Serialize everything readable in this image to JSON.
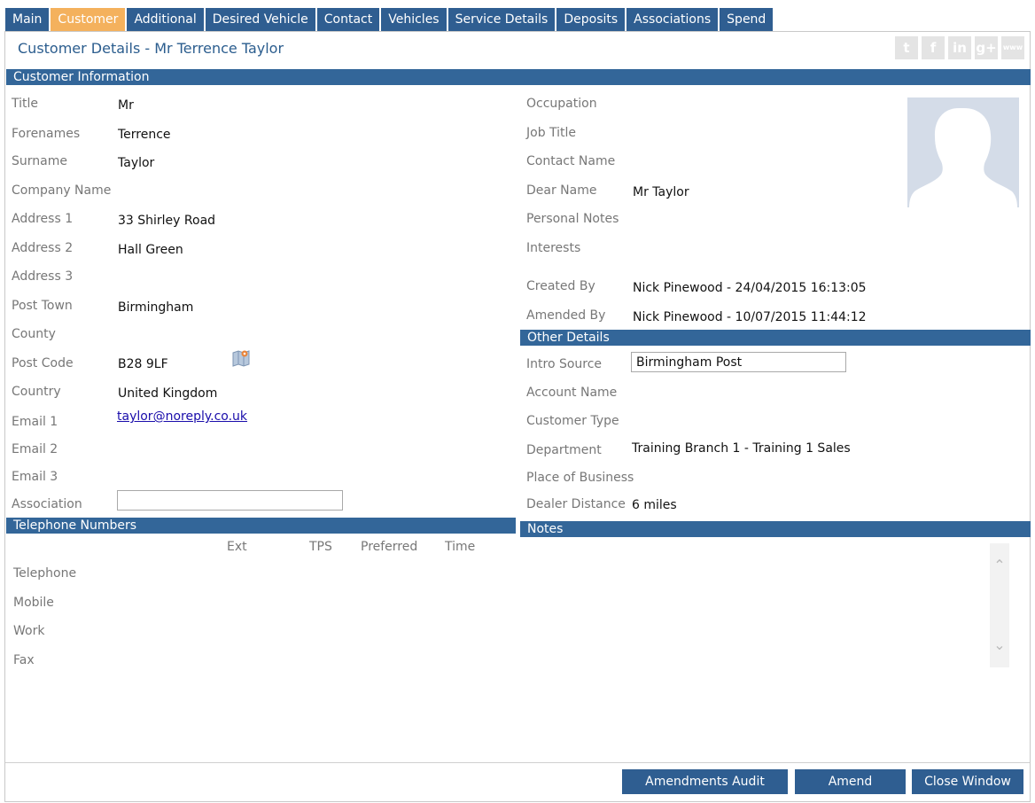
{
  "tabs": [
    "Main",
    "Customer",
    "Additional",
    "Desired Vehicle",
    "Contact",
    "Vehicles",
    "Service Details",
    "Deposits",
    "Associations",
    "Spend"
  ],
  "page_title": "Customer Details - Mr Terrence Taylor",
  "social": [
    "t",
    "f",
    "in",
    "g+",
    "www"
  ],
  "sections": {
    "customer_info": "Customer Information",
    "telephone": "Telephone Numbers",
    "other": "Other Details",
    "notes": "Notes"
  },
  "customer": {
    "title": {
      "label": "Title",
      "value": "Mr"
    },
    "forenames": {
      "label": "Forenames",
      "value": "Terrence"
    },
    "surname": {
      "label": "Surname",
      "value": "Taylor"
    },
    "company": {
      "label": "Company Name",
      "value": ""
    },
    "address1": {
      "label": "Address 1",
      "value": "33 Shirley Road"
    },
    "address2": {
      "label": "Address 2",
      "value": "Hall Green"
    },
    "address3": {
      "label": "Address 3",
      "value": ""
    },
    "post_town": {
      "label": "Post Town",
      "value": "Birmingham"
    },
    "county": {
      "label": "County",
      "value": ""
    },
    "post_code": {
      "label": "Post Code",
      "value": "B28 9LF"
    },
    "country": {
      "label": "Country",
      "value": "United Kingdom"
    },
    "email1": {
      "label": "Email 1",
      "value": "taylor@noreply.co.uk"
    },
    "email2": {
      "label": "Email 2",
      "value": ""
    },
    "email3": {
      "label": "Email 3",
      "value": ""
    },
    "association": {
      "label": "Association",
      "value": ""
    }
  },
  "right": {
    "occupation": {
      "label": "Occupation",
      "value": ""
    },
    "job_title": {
      "label": "Job Title",
      "value": ""
    },
    "contact_name": {
      "label": "Contact Name",
      "value": ""
    },
    "dear_name": {
      "label": "Dear Name",
      "value": "Mr Taylor"
    },
    "personal_notes": {
      "label": "Personal Notes",
      "value": ""
    },
    "interests": {
      "label": "Interests",
      "value": ""
    },
    "created_by": {
      "label": "Created By",
      "value": "Nick Pinewood - 24/04/2015 16:13:05"
    },
    "amended_by": {
      "label": "Amended By",
      "value": "Nick Pinewood - 10/07/2015 11:44:12"
    }
  },
  "other": {
    "intro_source": {
      "label": "Intro Source",
      "value": "Birmingham Post"
    },
    "account_name": {
      "label": "Account Name",
      "value": ""
    },
    "customer_type": {
      "label": "Customer Type",
      "value": ""
    },
    "department": {
      "label": "Department",
      "value": "Training Branch 1 - Training 1 Sales"
    },
    "place_of_business": {
      "label": "Place of Business",
      "value": ""
    },
    "dealer_distance": {
      "label": "Dealer Distance",
      "value": "6 miles"
    }
  },
  "telephone": {
    "columns": [
      "Ext",
      "TPS",
      "Preferred",
      "Time"
    ],
    "rows": [
      "Telephone",
      "Mobile",
      "Work",
      "Fax"
    ]
  },
  "buttons": {
    "amendments_audit": "Amendments Audit",
    "amend": "Amend",
    "close_window": "Close Window"
  },
  "colors": {
    "tab": "#2f5e91",
    "tab_active": "#f4b15d",
    "section_bar": "#336699",
    "title": "#2b5d8e"
  }
}
